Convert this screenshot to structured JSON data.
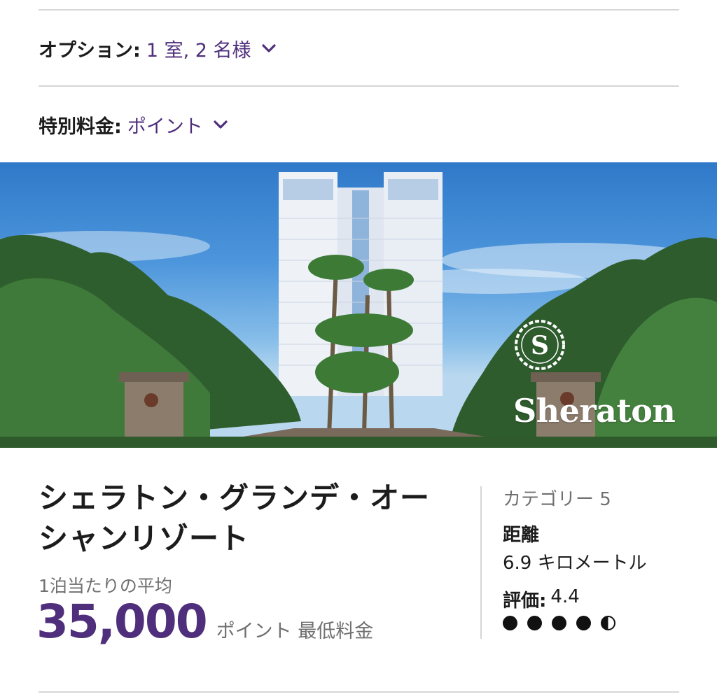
{
  "filters": {
    "options": {
      "label": "オプション:",
      "value": "1 室, 2 名様"
    },
    "special_rate": {
      "label": "特別料金:",
      "value": "ポイント"
    }
  },
  "hero": {
    "brand": "Sheraton",
    "logo_letter": "S"
  },
  "hotel": {
    "name": "シェラトン・グランデ・オーシャンリゾート",
    "avg_label": "1泊当たりの平均",
    "price": "35,000",
    "price_unit": "ポイント 最低料金",
    "category": "カテゴリー 5",
    "distance_label": "距離",
    "distance_value": "6.9 キロメートル",
    "rating_label": "評価:",
    "rating_value": "4.4",
    "rating_dots": {
      "full": 4,
      "half": 1,
      "max": 5
    }
  },
  "colors": {
    "accent": "#4f2f7c",
    "muted": "#707070",
    "divider": "#d6d6d6"
  }
}
